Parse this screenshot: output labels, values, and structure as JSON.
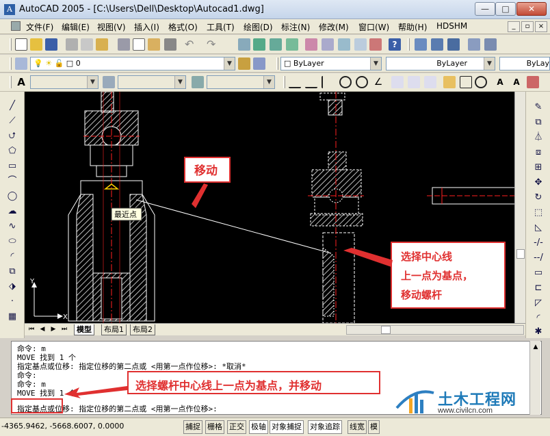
{
  "window": {
    "title": "AutoCAD 2005 - [C:\\Users\\Dell\\Desktop\\Autocad1.dwg]",
    "min_glyph": "—",
    "max_glyph": "□",
    "close_glyph": "✕"
  },
  "menu": {
    "items": [
      "文件(F)",
      "编辑(E)",
      "视图(V)",
      "插入(I)",
      "格式(O)",
      "工具(T)",
      "绘图(D)",
      "标注(N)",
      "修改(M)",
      "窗口(W)",
      "帮助(H)",
      "HDSHM"
    ]
  },
  "layers": {
    "current_layer": "0",
    "color": "ByLayer",
    "linetype": "ByLayer",
    "lineweight": "ByLay"
  },
  "canvas": {
    "tooltip": "最近点",
    "ucs_x": "X",
    "ucs_y": "Y"
  },
  "annotations": {
    "move_label": "移动",
    "select_note_line1": "选择中心线",
    "select_note_line2": "上一点为基点，",
    "select_note_line3": "移动螺杆",
    "cmd_note": "选择螺杆中心线上一点为基点，并移动"
  },
  "layout_tabs": [
    "模型",
    "布局1",
    "布局2"
  ],
  "command_history": [
    "命令: m",
    "MOVE 找到 1 个",
    "指定基点或位移: 指定位移的第二点或 <用第一点作位移>: *取消*",
    "命令:",
    "命令: m",
    "MOVE 找到 1 个",
    "指定基点或位移: 指定位移的第二点或 <用第一点作位移>:"
  ],
  "status": {
    "coords": "-4365.9462, -5668.6007, 0.0000",
    "buttons": [
      "捕捉",
      "栅格",
      "正交",
      "极轴",
      "对象捕捉",
      "对象追踪",
      "线宽",
      "模"
    ]
  },
  "watermark": {
    "title": "土木工程网",
    "url": "www.civilcn.com"
  },
  "colors": {
    "annotation_red": "#e03030",
    "canvas_bg": "#000000",
    "cad_white": "#ffffff",
    "cad_red": "#ff2020",
    "watermark_blue": "#1e7ab8"
  }
}
